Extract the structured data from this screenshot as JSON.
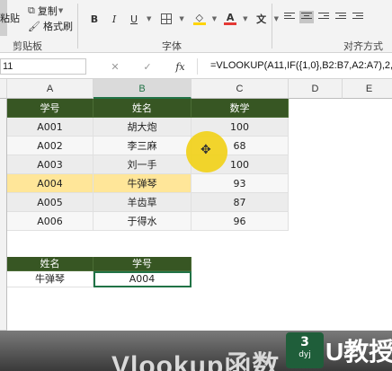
{
  "ribbon": {
    "clipboard": {
      "paste": "粘贴",
      "copy": "复制",
      "format_painter": "格式刷",
      "group_label": "剪贴板"
    },
    "font": {
      "bold": "B",
      "italic": "I",
      "underline": "U",
      "fill_color_glyph": "◇",
      "font_color_glyph": "A",
      "phonetic_glyph": "文",
      "group_label": "字体"
    },
    "alignment": {
      "group_label": "对齐方式"
    }
  },
  "formula_bar": {
    "name_box": "11",
    "cancel": "✕",
    "confirm": "✓",
    "fx": "fx",
    "formula": "=VLOOKUP(A11,IF({1,0},B2:B7,A2:A7),2,0"
  },
  "columns": [
    "A",
    "B",
    "C",
    "D",
    "E"
  ],
  "table": {
    "headers": [
      "学号",
      "姓名",
      "数学"
    ],
    "rows": [
      [
        "A001",
        "胡大炮",
        "100"
      ],
      [
        "A002",
        "李三麻",
        "68"
      ],
      [
        "A003",
        "刘一手",
        "100"
      ],
      [
        "A004",
        "牛弹琴",
        "93"
      ],
      [
        "A005",
        "羊齿草",
        "87"
      ],
      [
        "A006",
        "于得水",
        "96"
      ]
    ],
    "highlighted_row": 3
  },
  "lookup": {
    "headers": [
      "姓名",
      "学号"
    ],
    "values": [
      "牛弹琴",
      "A004"
    ]
  },
  "cursor_glyph": "✥",
  "banner": {
    "title": "Vlookup函数",
    "logo_text": "U教授",
    "logo_small_a": "3",
    "logo_small_b": "dyj"
  },
  "colors": {
    "header_fill": "#375623",
    "highlight": "#ffe699",
    "excel_green": "#217346",
    "cursor": "#f2d21b"
  }
}
